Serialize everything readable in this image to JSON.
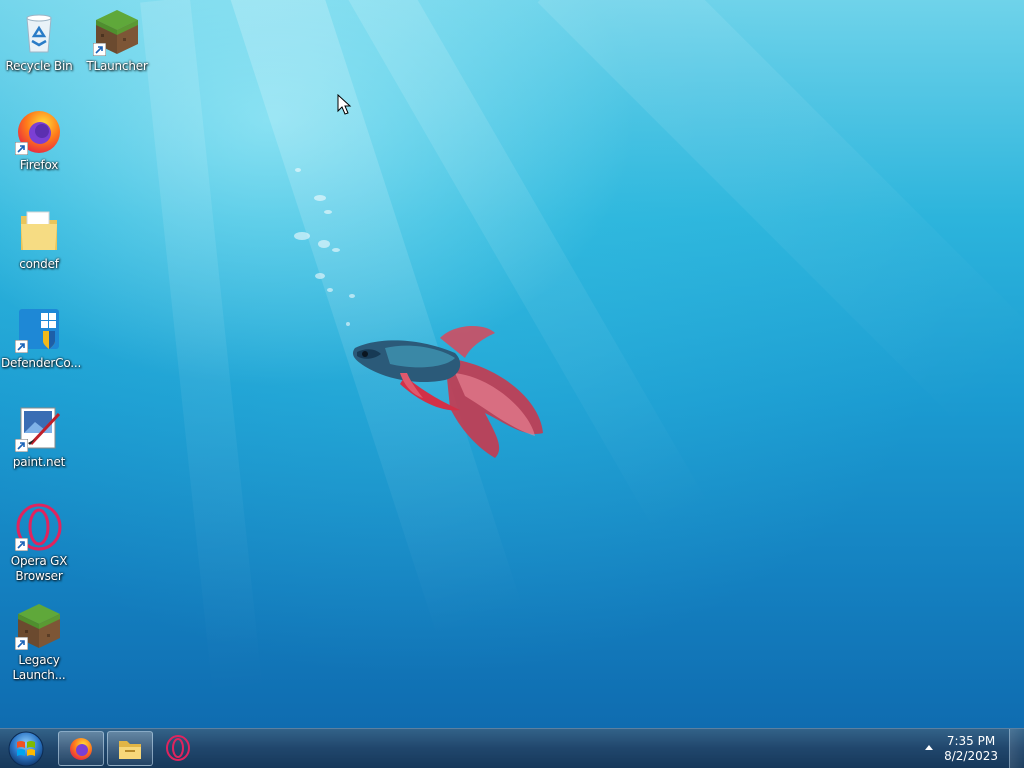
{
  "desktop": {
    "icons": [
      {
        "label": "Recycle Bin",
        "icon": "recycle-bin-icon"
      },
      {
        "label": "TLauncher",
        "icon": "minecraft-grass-block-icon"
      },
      {
        "label": "Firefox",
        "icon": "firefox-icon"
      },
      {
        "label": "condef",
        "icon": "folder-icon"
      },
      {
        "label": "DefenderCo...",
        "icon": "windows-defender-icon"
      },
      {
        "label": "paint.net",
        "icon": "paint-net-icon"
      },
      {
        "label": "Opera GX Browser",
        "icon": "opera-gx-icon"
      },
      {
        "label": "Legacy Launch...",
        "icon": "minecraft-grass-block-icon"
      }
    ]
  },
  "taskbar": {
    "start": {
      "icon": "windows-start-orb-icon"
    },
    "items": [
      {
        "name": "Firefox",
        "icon": "firefox-icon",
        "pinned": true
      },
      {
        "name": "Windows Explorer",
        "icon": "file-explorer-icon",
        "pinned": true
      },
      {
        "name": "Opera GX",
        "icon": "opera-gx-icon",
        "pinned": false
      }
    ],
    "tray": {
      "overflow_icon": "tray-overflow-arrow-icon",
      "time": "7:35 PM",
      "date": "8/2/2023"
    }
  },
  "colors": {
    "wallpaper_light": "#6fd3ea",
    "wallpaper_dark": "#0f6cb0",
    "taskbar": "#1d4c78"
  }
}
